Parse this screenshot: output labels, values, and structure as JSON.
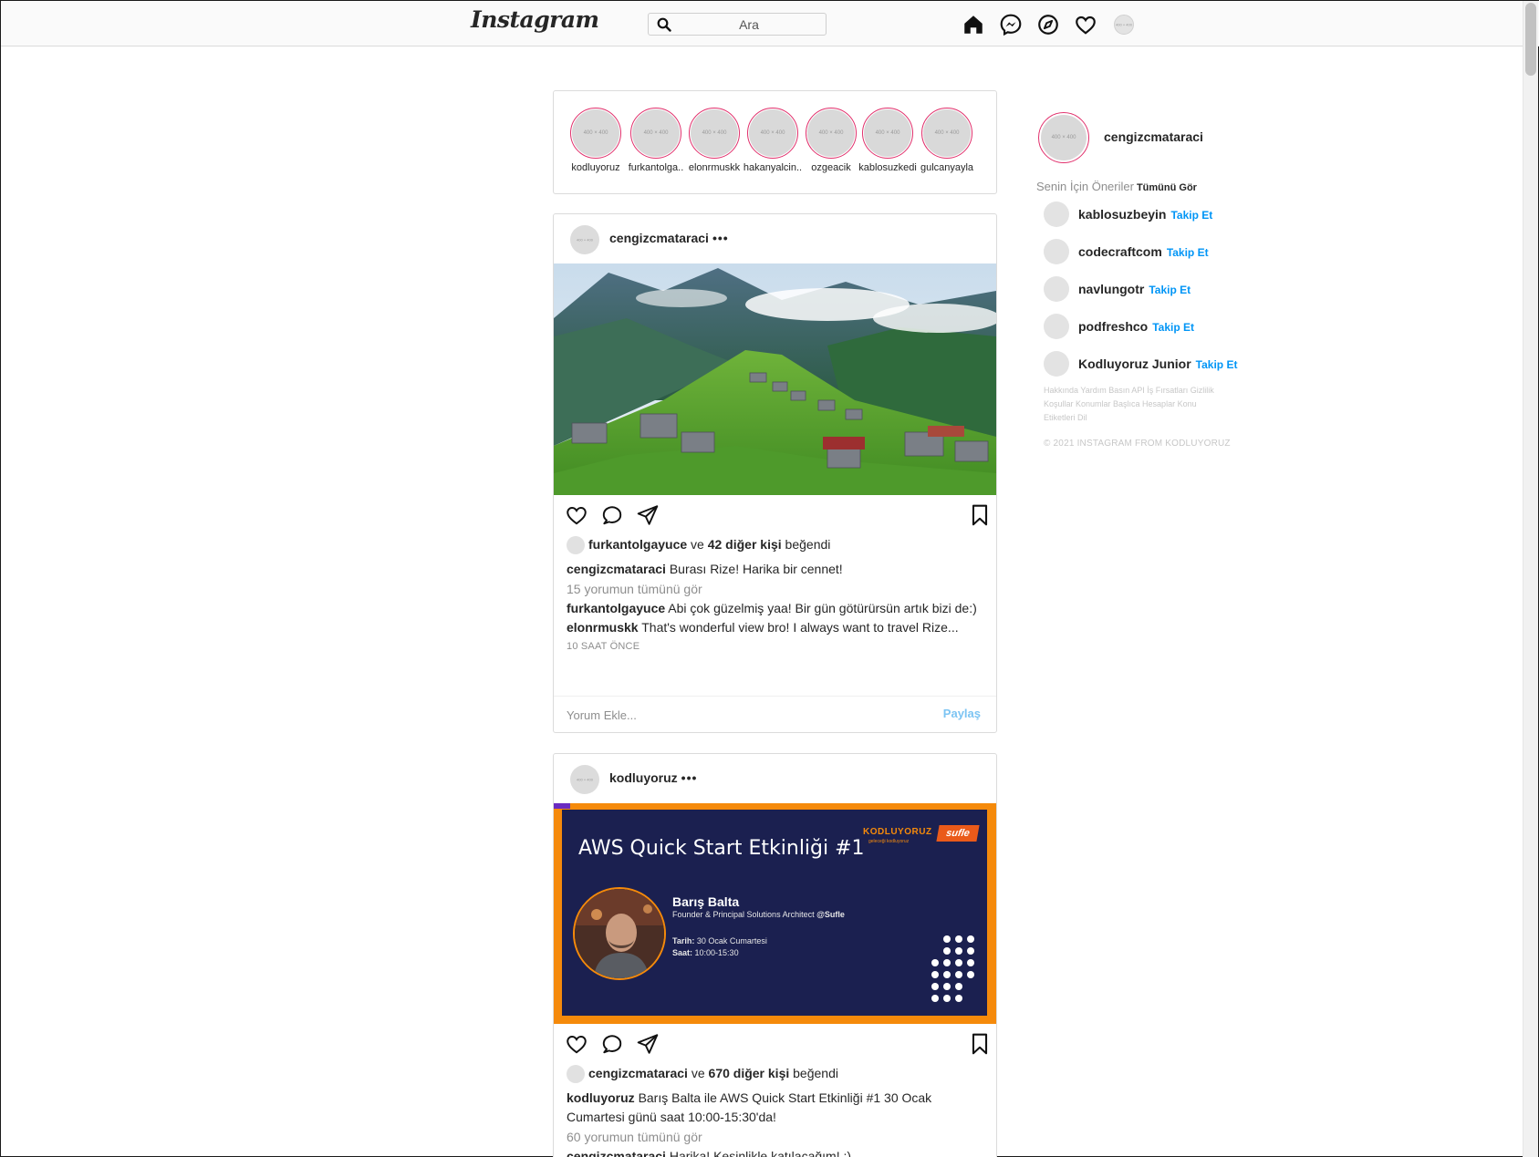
{
  "topbar": {
    "logo": "Instagram",
    "search_placeholder": "Ara",
    "icons": [
      "home-icon",
      "messenger-icon",
      "explore-icon",
      "activity-heart-icon",
      "profile-avatar"
    ]
  },
  "placeholder_label": "400 × 400",
  "stories": [
    {
      "name": "kodluyoruz"
    },
    {
      "name": "furkantolga.."
    },
    {
      "name": "elonrmuskk"
    },
    {
      "name": "hakanyalcin.."
    },
    {
      "name": "ozgeacik"
    },
    {
      "name": "kablosuzkedi"
    },
    {
      "name": "gulcanyayla"
    }
  ],
  "posts": [
    {
      "user": "cengizcmataraci",
      "more": "•••",
      "liked_by": "furkantolgayuce",
      "likes_joiner": "ve",
      "likes_others": "42 diğer kişi",
      "likes_suffix": "beğendi",
      "caption_user": "cengizcmataraci",
      "caption_text": "Burası Rize! Harika bir cennet!",
      "view_comments": "15 yorumun tümünü gör",
      "comments": [
        {
          "user": "furkantolgayuce",
          "text": "Abi çok güzelmiş yaa! Bir gün götürürsün artık bizi de:)"
        },
        {
          "user": "elonrmuskk",
          "text": "That's wonderful view bro! I always want to travel Rize..."
        }
      ],
      "time": "10 SAAT ÖNCE",
      "comment_placeholder": "Yorum Ekle...",
      "share_label": "Paylaş"
    },
    {
      "user": "kodluyoruz",
      "more": "•••",
      "event": {
        "title": "AWS Quick Start Etkinliği #1",
        "brand": "KODLUYORUZ",
        "brand_tagline": "geleceği kodluyoruz",
        "partner": "sufle",
        "speaker": "Barış Balta",
        "speaker_role": "Founder & Principal Solutions Architect",
        "speaker_org": "@Sufle",
        "date_label": "Tarih:",
        "date_value": "30 Ocak Cumartesi",
        "hour_label": "Saat:",
        "hour_value": "10:00-15:30"
      },
      "liked_by": "cengizcmataraci",
      "likes_joiner": "ve",
      "likes_others": "670 diğer kişi",
      "likes_suffix": "beğendi",
      "caption_user": "kodluyoruz",
      "caption_text": "Barış Balta ile AWS Quick Start Etkinliği #1 30 Ocak Cumartesi günü saat 10:00-15:30'da!",
      "view_comments": "60 yorumun tümünü gör",
      "comments": [
        {
          "user": "cengizcmataraci",
          "text": "Harika! Kesinlikle katılacağım! :)"
        }
      ]
    }
  ],
  "sidebar": {
    "username": "cengizcmataraci",
    "suggestions_title": "Senin İçin Öneriler",
    "see_all": "Tümünü Gör",
    "follow_label": "Takip Et",
    "suggestions": [
      {
        "name": "kablosuzbeyin"
      },
      {
        "name": "codecraftcom"
      },
      {
        "name": "navlungotr"
      },
      {
        "name": "podfreshco"
      },
      {
        "name": "Kodluyoruz Junior"
      }
    ],
    "footer_links": "Hakkında Yardım Basın API İş Fırsatları Gizlilik Koşullar Konumlar Başlıca Hesaplar Konu Etiketleri Dil",
    "copyright": "© 2021 INSTAGRAM FROM KODLUYORUZ"
  },
  "colors": {
    "story_ring": "#e1306c",
    "follow_blue": "#0095f6",
    "share_blue": "#7cc4f3",
    "event_navy": "#1b2050",
    "event_orange": "#f58a0b"
  }
}
